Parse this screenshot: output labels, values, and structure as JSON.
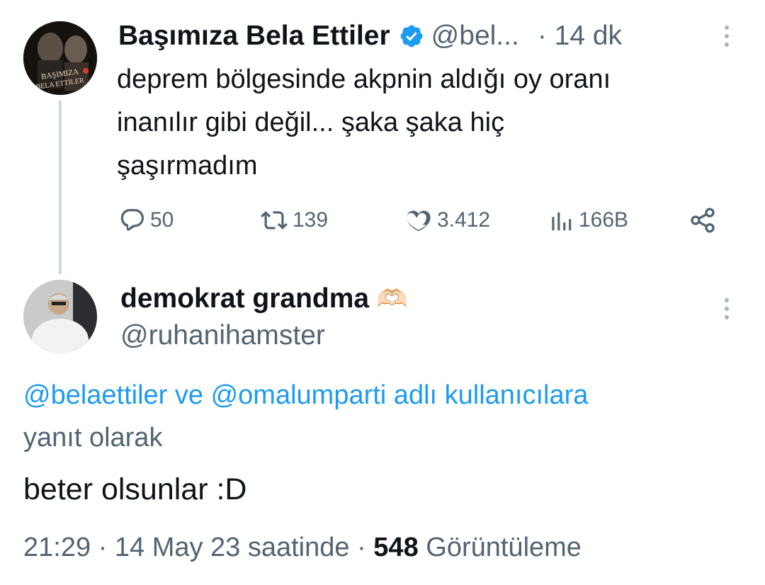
{
  "tweet": {
    "author_name": "Başımıza Bela Ettiler",
    "author_handle": "@bel...",
    "time": "· 14 dk",
    "avatar_text": [
      "BAŞIMIZA",
      "BELA ETTİLER"
    ],
    "text_lines": [
      "deprem bölgesinde akpnin aldığı oy oranı",
      "inanılır gibi değil... şaka şaka hiç",
      "şaşırmadım"
    ],
    "replies": "50",
    "retweets": "139",
    "likes": "3.412",
    "views": "166B"
  },
  "reply": {
    "author_name": "demokrat grandma",
    "author_emoji": "🫶🏻",
    "author_handle": "@ruhanihamster",
    "mention1": "@belaettiler",
    "mention_joiner": " ve ",
    "mention2": "@omalumparti",
    "reply_suffix_1": " adlı kullanıcılara",
    "reply_suffix_2": "yanıt olarak",
    "text": "beter olsunlar :D",
    "time": "21:29 · 14 May 23 saatinde · ",
    "view_count": "548",
    "view_label": " Görüntüleme"
  },
  "colors": {
    "accent": "#1d9bf0",
    "secondary_text": "#536471",
    "primary_text": "#0f1419"
  }
}
